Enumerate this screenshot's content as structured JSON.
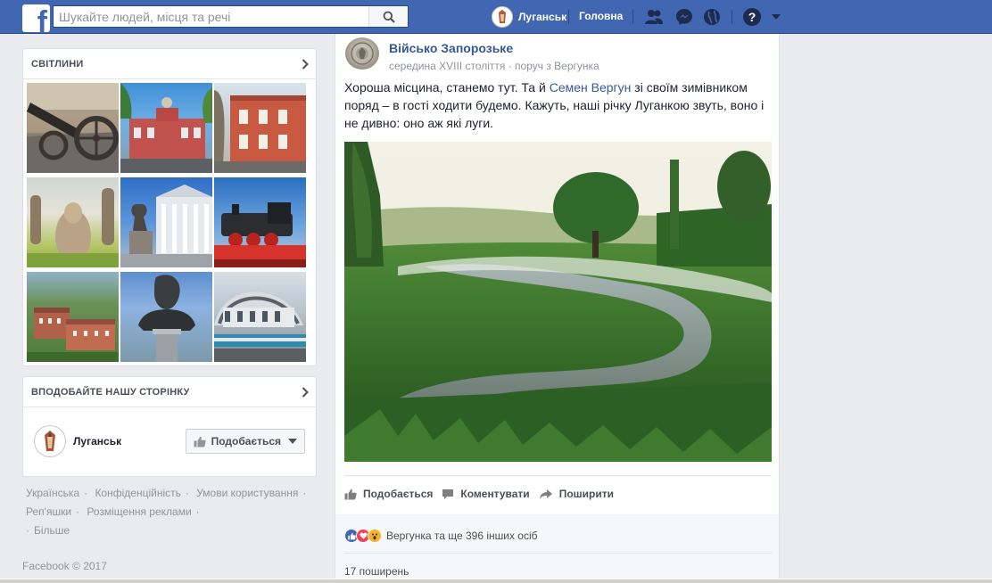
{
  "topbar": {
    "logo": "f",
    "search_placeholder": "Шукайте людей, місця та речі",
    "profile_name": "Луганськ",
    "home_label": "Головна",
    "icons": [
      "friend-requests-icon",
      "messenger-icon",
      "notifications-globe-icon",
      "help-icon",
      "account-menu-caret-icon"
    ]
  },
  "photos_card": {
    "title": "СВІТЛИНИ",
    "photos": [
      {
        "name": "cannon"
      },
      {
        "name": "red-building"
      },
      {
        "name": "brick-house"
      },
      {
        "name": "stone-statues"
      },
      {
        "name": "columned-building"
      },
      {
        "name": "locomotive"
      },
      {
        "name": "aerial-city"
      },
      {
        "name": "bust-statue"
      },
      {
        "name": "railway-station"
      }
    ]
  },
  "like_page_card": {
    "title": "ВПОДОБАЙТЕ НАШУ СТОРІНКУ",
    "page_name": "Луганськ",
    "like_button": "Подобається"
  },
  "footer": {
    "links": [
      "Українська",
      "Конфіденційність",
      "Умови користування",
      "Реп'яшки",
      "Розміщення реклами",
      "Більше"
    ],
    "separator": "·",
    "copyright": "Facebook © 2017"
  },
  "post": {
    "author": "Військо Запорозьке",
    "meta": "середина XVIII століття · поруч з Вергунка",
    "text_before_link": "Хороша місцина, станемо тут. Та й ",
    "text_link": "Семен Вергун",
    "text_after_link": " зі своїм зимівником поряд – в гості ходити будемо. Кажуть, наші річку Луганкою звуть, воно і не дивно: оно аж які луги.",
    "actions": {
      "like": "Подобається",
      "comment": "Коментувати",
      "share": "Поширити"
    },
    "reactions_text": "Вергунка та ще 396 інших осіб",
    "shares_text": "17 поширень",
    "colors": {
      "link": "#365899",
      "like_blue": "#4267b2",
      "love_red": "#f33e58",
      "wow_yellow": "#f7b125"
    }
  }
}
